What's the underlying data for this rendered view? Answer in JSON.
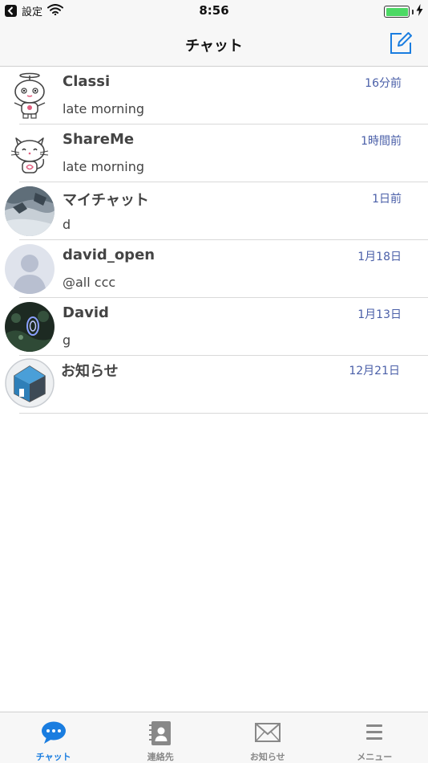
{
  "status_bar": {
    "back_label": "設定",
    "time": "8:56",
    "battery_level": 1.0
  },
  "nav": {
    "title": "チャット"
  },
  "chats": [
    {
      "name": "Classi",
      "time": "16分前",
      "message": "late morning",
      "avatar": "robot-mascot-icon"
    },
    {
      "name": "ShareMe",
      "time": "1時間前",
      "message": "late morning",
      "avatar": "cat-mascot-icon"
    },
    {
      "name": "マイチャット",
      "time": "1日前",
      "message": "d",
      "avatar": "photo-avatar"
    },
    {
      "name": "david_open",
      "time": "1月18日",
      "message": "@all ccc",
      "avatar": "default-person-icon"
    },
    {
      "name": "David",
      "time": "1月13日",
      "message": "g",
      "avatar": "photo-avatar"
    },
    {
      "name": "お知らせ",
      "time": "12月21日",
      "message": "",
      "avatar": "house-logo-icon"
    }
  ],
  "tabs": [
    {
      "label": "チャット",
      "icon": "chat-bubble-icon",
      "active": true
    },
    {
      "label": "連絡先",
      "icon": "address-book-icon",
      "active": false
    },
    {
      "label": "お知らせ",
      "icon": "mail-icon",
      "active": false
    },
    {
      "label": "メニュー",
      "icon": "menu-icon",
      "active": false
    }
  ],
  "colors": {
    "accent": "#1a7de0",
    "time_text": "#4a5fa8",
    "battery": "#4cd964"
  }
}
